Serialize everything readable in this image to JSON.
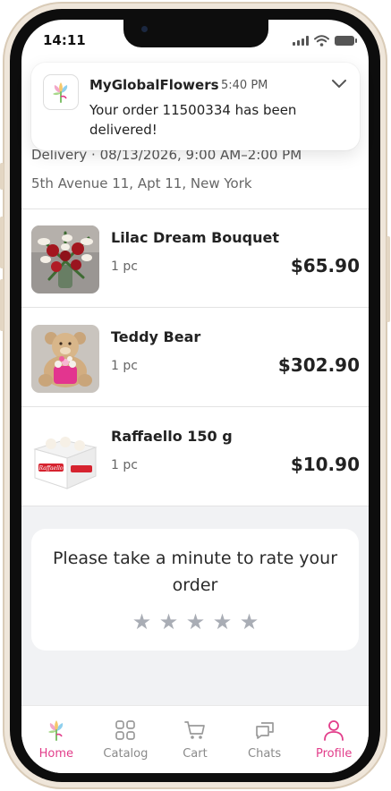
{
  "status_bar": {
    "time": "14:11"
  },
  "notification": {
    "app_name": "MyGlobalFlowers",
    "time": "5:40 PM",
    "message": "Your order 11500334 has been delivered!",
    "icon": "flower-logo-icon"
  },
  "order": {
    "delivery": "Delivery · 08/13/2026, 9:00 AM–2:00 PM",
    "address": "5th Avenue 11, Apt 11, New York",
    "items": [
      {
        "name": "Lilac Dream Bouquet",
        "qty": "1 pc",
        "price": "$65.90",
        "image": "lilac-bouquet-image"
      },
      {
        "name": "Teddy Bear",
        "qty": "1 pc",
        "price": "$302.90",
        "image": "teddy-bear-image"
      },
      {
        "name": "Raffaello 150 g",
        "qty": "1 pc",
        "price": "$10.90",
        "image": "raffaello-box-image"
      }
    ]
  },
  "rating": {
    "prompt": "Please take a minute to rate your order",
    "max_stars": 5,
    "selected_stars": 0
  },
  "tab_bar": {
    "tabs": [
      {
        "label": "Home",
        "icon": "home-flower-icon",
        "active": true
      },
      {
        "label": "Catalog",
        "icon": "grid-icon",
        "active": false
      },
      {
        "label": "Cart",
        "icon": "cart-icon",
        "active": false
      },
      {
        "label": "Chats",
        "icon": "chat-bubbles-icon",
        "active": false
      },
      {
        "label": "Profile",
        "icon": "person-icon",
        "active": false
      }
    ]
  },
  "colors": {
    "accent": "#e23d8a",
    "star_inactive": "#a9adb5",
    "inactive_tab": "#8a8a8a"
  }
}
